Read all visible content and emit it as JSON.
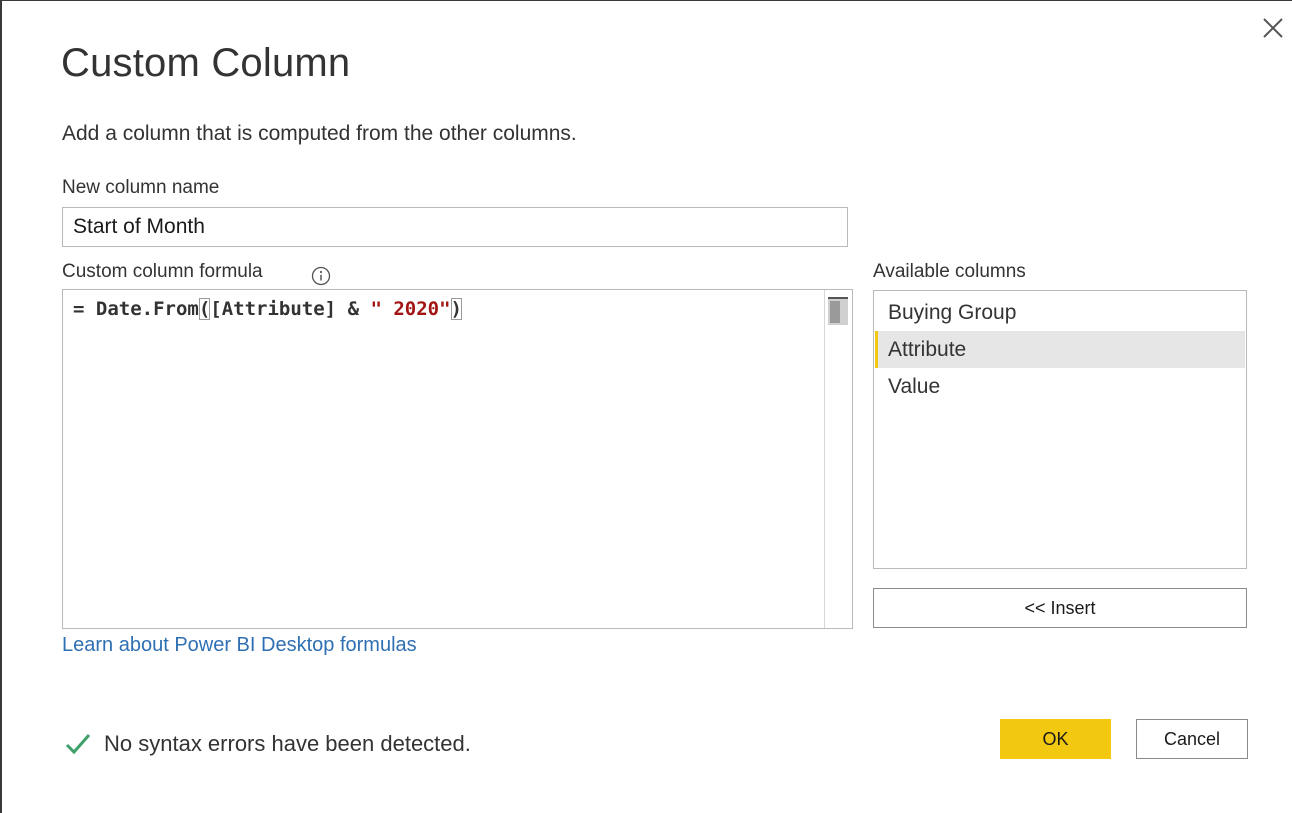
{
  "dialog": {
    "title": "Custom Column",
    "subtitle": "Add a column that is computed from the other columns.",
    "close_icon": "close-icon"
  },
  "name_field": {
    "label": "New column name",
    "value": "Start of Month"
  },
  "formula": {
    "label": "Custom column formula",
    "info_icon": "info-icon",
    "prefix": "= Date.From",
    "open_paren": "(",
    "middle": "[Attribute] & ",
    "string": "\" 2020\"",
    "close_paren": ")"
  },
  "learn_link": "Learn about Power BI Desktop formulas",
  "available_columns": {
    "label": "Available columns",
    "items": [
      "Buying Group",
      "Attribute",
      "Value"
    ],
    "selected": "Attribute"
  },
  "insert_label": "<< Insert",
  "status": {
    "icon": "check-icon",
    "text": "No syntax errors have been detected."
  },
  "buttons": {
    "ok": "OK",
    "cancel": "Cancel"
  },
  "colors": {
    "accent": "#F2C811",
    "link": "#2F6FB3",
    "success": "#3FA06A",
    "string": "#A31515"
  }
}
